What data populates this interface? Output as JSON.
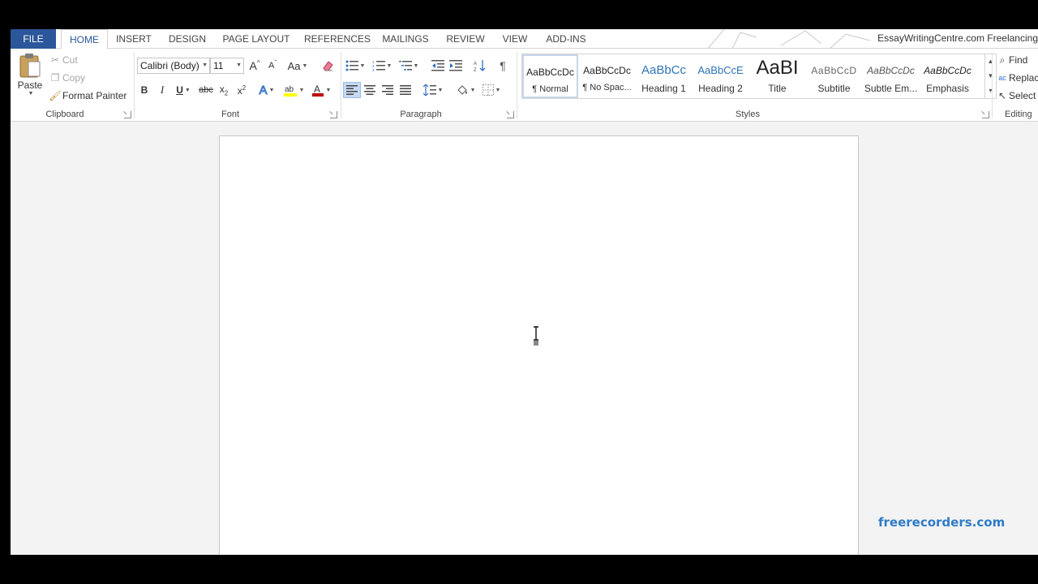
{
  "tabs": [
    "FILE",
    "HOME",
    "INSERT",
    "DESIGN",
    "PAGE LAYOUT",
    "REFERENCES",
    "MAILINGS",
    "REVIEW",
    "VIEW",
    "ADD-INS"
  ],
  "active_tab": "HOME",
  "account_text": "EssayWritingCentre.com Freelancing",
  "clipboard": {
    "paste": "Paste",
    "cut": "Cut",
    "copy": "Copy",
    "format_painter": "Format Painter",
    "label": "Clipboard"
  },
  "font": {
    "name": "Calibri (Body)",
    "size": "11",
    "label": "Font",
    "bold": "B",
    "italic": "I",
    "underline": "U",
    "strike": "abc",
    "grow": "A",
    "shrink": "A",
    "case": "Aa"
  },
  "paragraph": {
    "label": "Paragraph"
  },
  "styles": {
    "label": "Styles",
    "items": [
      {
        "sample": "AaBbCcDc",
        "name": "¶ Normal"
      },
      {
        "sample": "AaBbCcDc",
        "name": "¶ No Spac..."
      },
      {
        "sample": "AaBbCc",
        "name": "Heading 1"
      },
      {
        "sample": "AaBbCcE",
        "name": "Heading 2"
      },
      {
        "sample": "AaBI",
        "name": "Title"
      },
      {
        "sample": "AaBbCcD",
        "name": "Subtitle"
      },
      {
        "sample": "AaBbCcDc",
        "name": "Subtle Em..."
      },
      {
        "sample": "AaBbCcDc",
        "name": "Emphasis"
      }
    ]
  },
  "editing": {
    "label": "Editing",
    "find": "Find",
    "replace": "Replace",
    "select": "Select"
  },
  "watermark": "freerecorders.com",
  "colors": {
    "file_tab": "#2b579a",
    "accent": "#2b579a",
    "watermark": "#2e7bc7",
    "highlight": "#ffff00",
    "font_color": "#c00000"
  }
}
